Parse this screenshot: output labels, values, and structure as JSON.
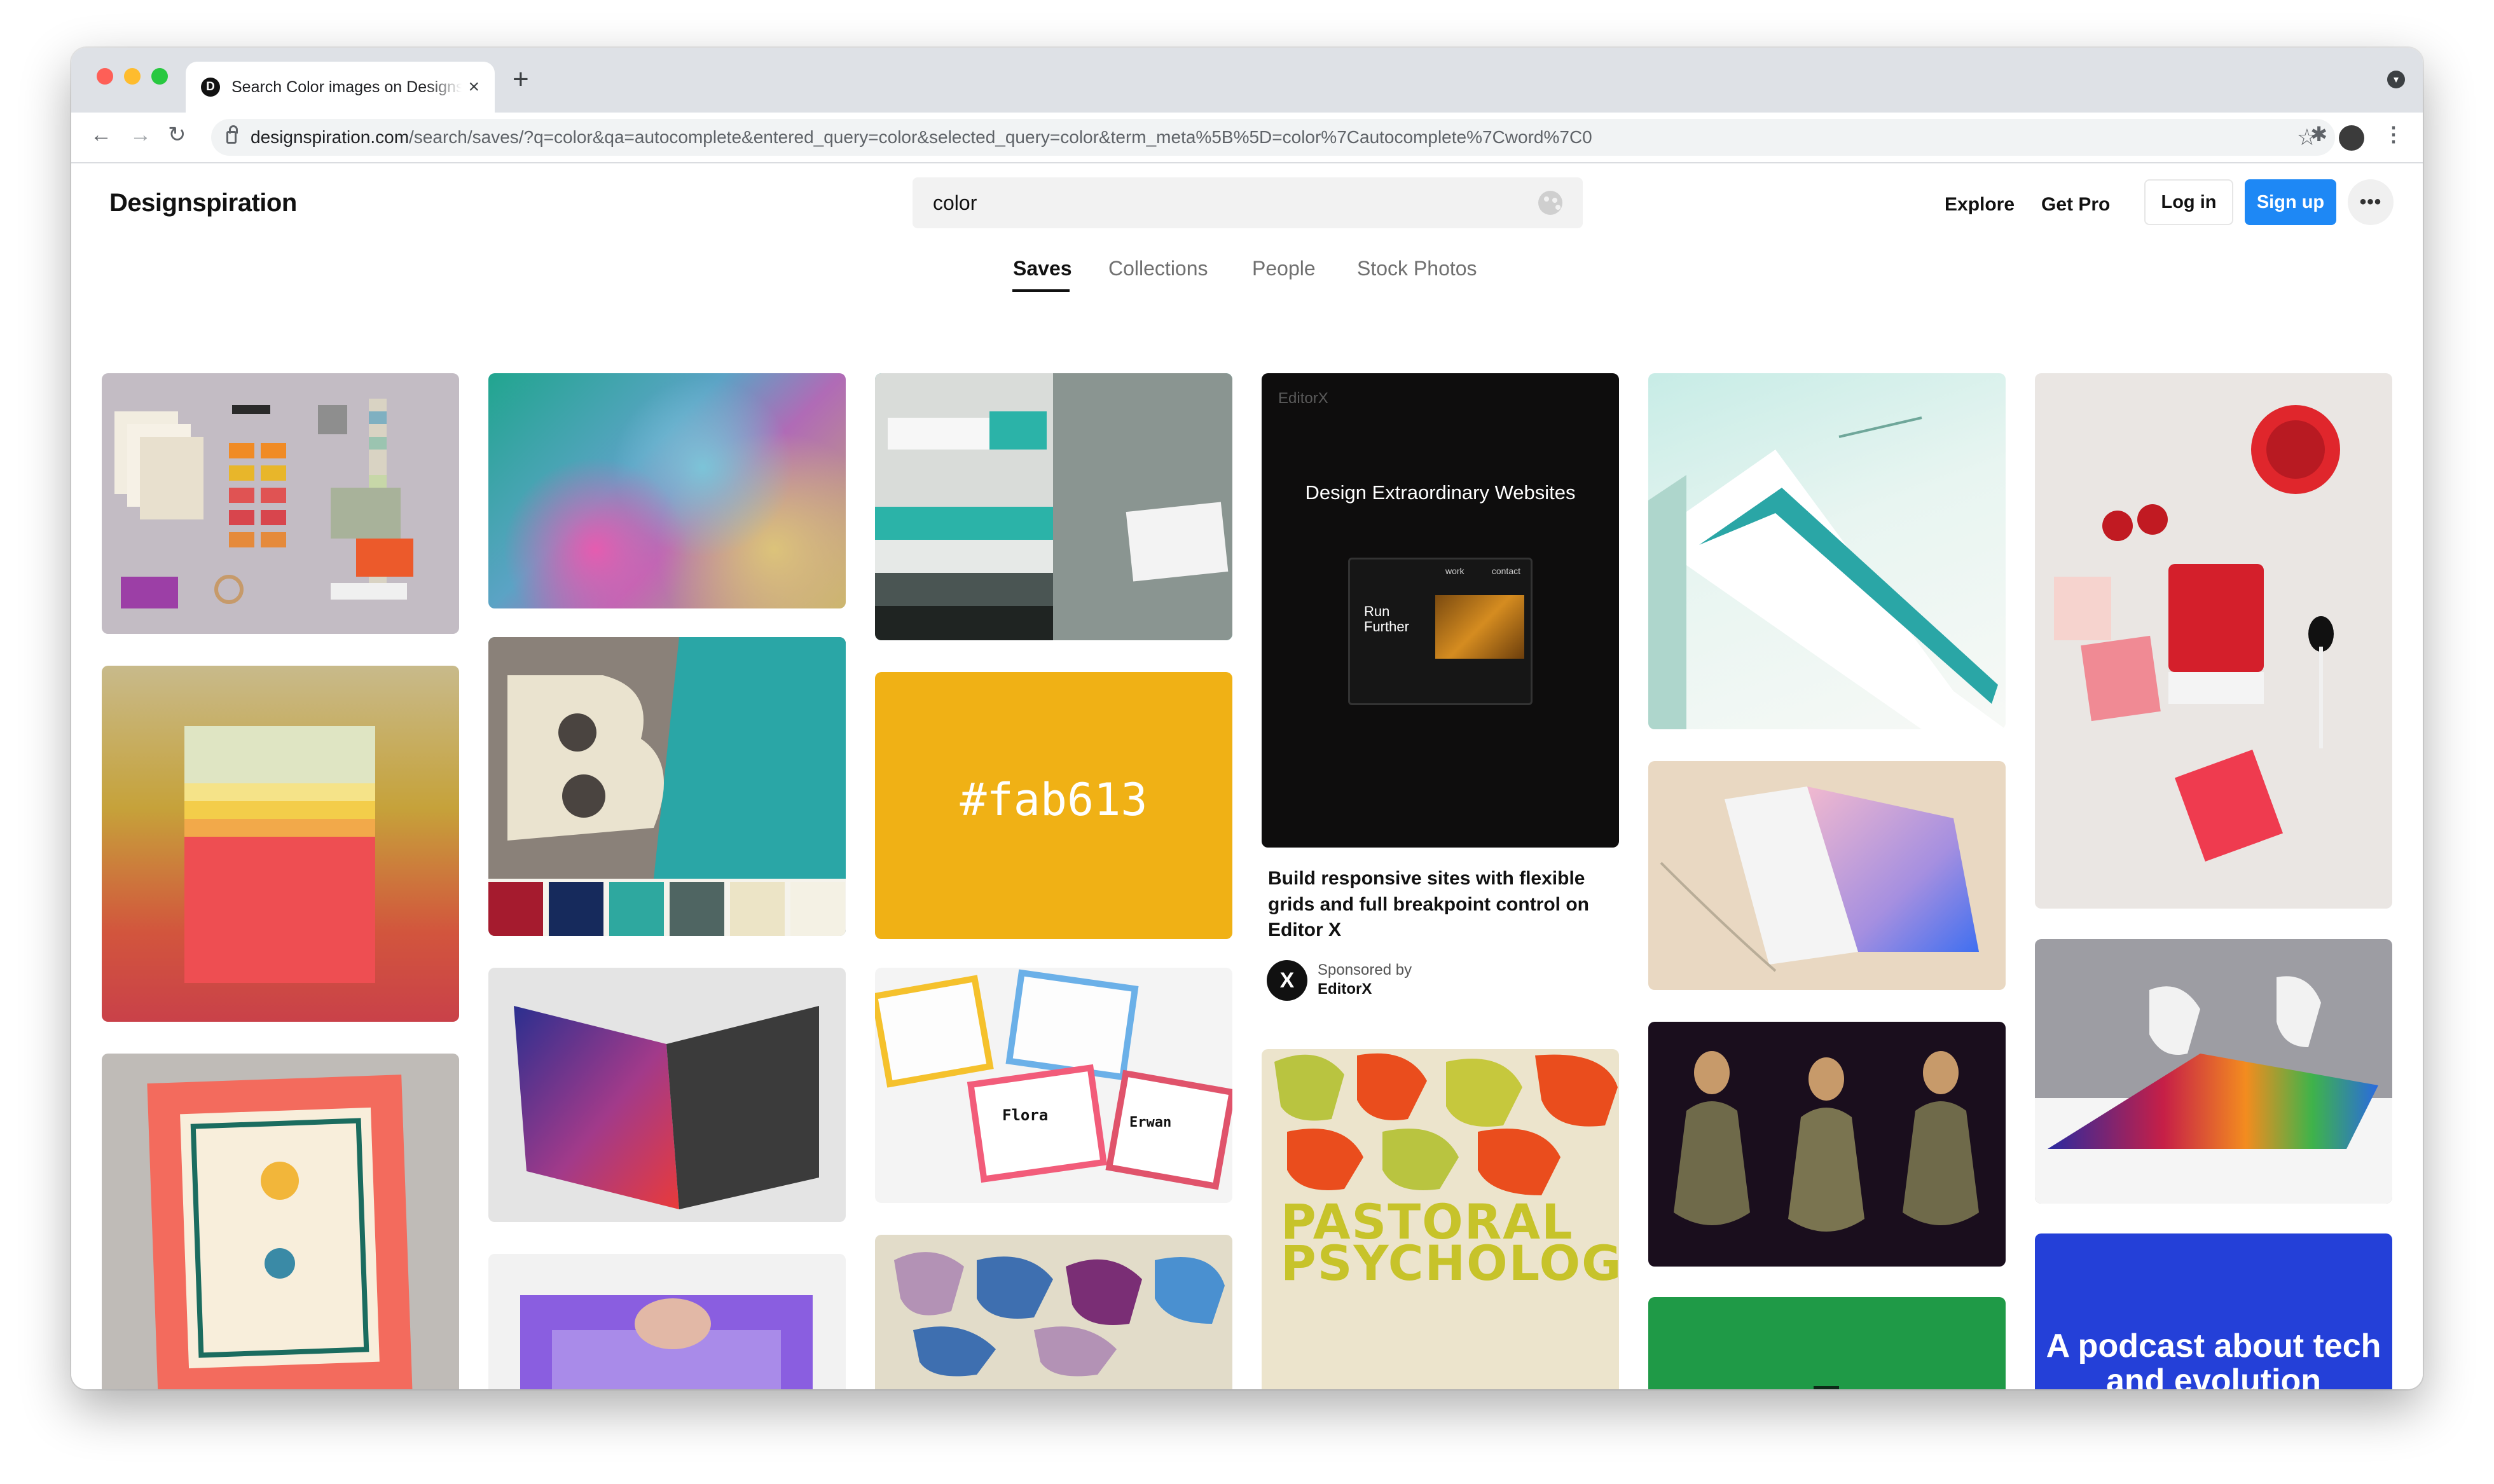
{
  "browser": {
    "tab_title": "Search Color images on Designspiration",
    "tab_favicon_letter": "D",
    "url_host": "designspiration.com",
    "url_path": "/search/saves/?q=color&qa=autocomplete&entered_query=color&selected_query=color&term_meta%5B%5D=color%7Cautocomplete%7Cword%7C0"
  },
  "header": {
    "logo": "Designspiration",
    "search_value": "color",
    "explore": "Explore",
    "get_pro": "Get Pro",
    "login": "Log in",
    "signup": "Sign up",
    "more": "•••",
    "accent_color": "#1e88f5"
  },
  "tabs": [
    {
      "label": "Saves",
      "active": true
    },
    {
      "label": "Collections",
      "active": false
    },
    {
      "label": "People",
      "active": false
    },
    {
      "label": "Stock Photos",
      "active": false
    }
  ],
  "tiles": {
    "hex": "#fab613",
    "ad": {
      "eyebrow": "EditorX",
      "headline": "Design Extraordinary Websites",
      "screen_line1": "Run",
      "screen_line2": "Further",
      "screen_nav_work": "work",
      "screen_nav_contact": "contact",
      "title": "Build responsive sites with flexible grids and full breakpoint control on Editor X",
      "sponsor_label": "Sponsored by",
      "sponsor_name": "EditorX",
      "sponsor_logo": "X",
      "menu": "•••"
    },
    "pastoral_1": "PASTORAL PSYCHOLOGY",
    "pastoral_2": "PASTORAL",
    "podcast": "A podcast about tech and evolution"
  }
}
